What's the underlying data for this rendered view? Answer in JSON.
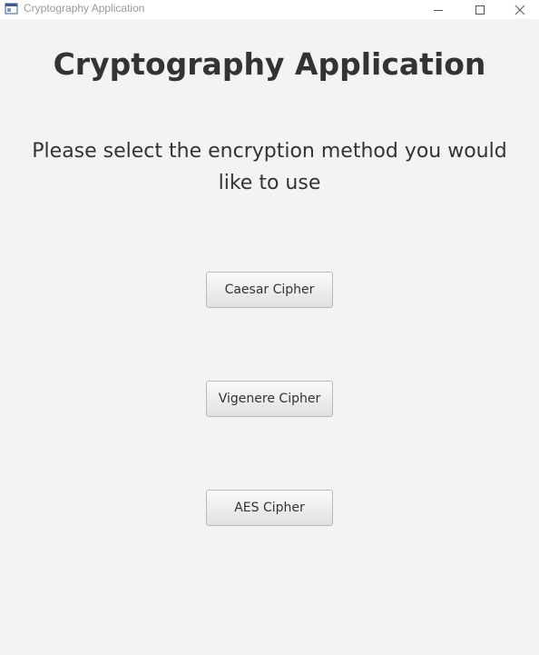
{
  "window": {
    "title": "Cryptography Application"
  },
  "main": {
    "heading": "Cryptography Application",
    "prompt": "Please select the encryption method you would like to use",
    "buttons": [
      {
        "label": "Caesar Cipher"
      },
      {
        "label": "Vigenere Cipher"
      },
      {
        "label": "AES Cipher"
      }
    ]
  }
}
